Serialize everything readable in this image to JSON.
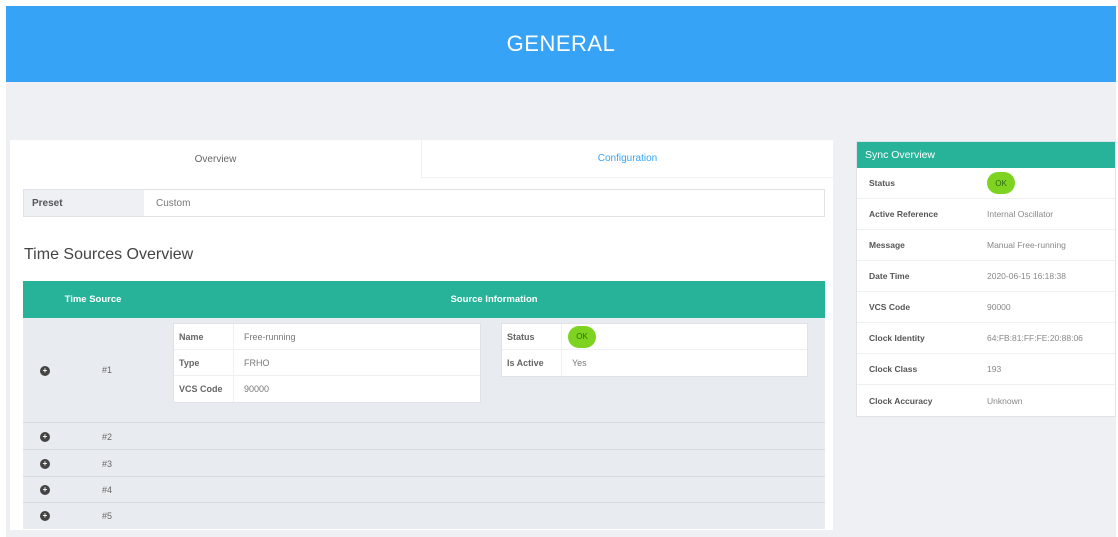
{
  "header": {
    "title": "GENERAL"
  },
  "tabs": [
    {
      "label": "Overview",
      "active": true
    },
    {
      "label": "Configuration",
      "active": false
    }
  ],
  "preset": {
    "label": "Preset",
    "value": "Custom"
  },
  "time_sources": {
    "title": "Time Sources Overview",
    "columns": [
      "Time Source",
      "Source Information"
    ],
    "rows": [
      {
        "index": "#1",
        "expanded": true,
        "details": [
          {
            "key": "Name",
            "value": "Free-running"
          },
          {
            "key": "Type",
            "value": "FRHO"
          },
          {
            "key": "VCS Code",
            "value": "90000"
          }
        ],
        "status": [
          {
            "key": "Status",
            "value": "OK"
          },
          {
            "key": "Is Active",
            "value": "Yes"
          }
        ]
      },
      {
        "index": "#2"
      },
      {
        "index": "#3"
      },
      {
        "index": "#4"
      },
      {
        "index": "#5"
      }
    ]
  },
  "sync_overview": {
    "title": "Sync Overview",
    "rows": [
      {
        "key": "Status",
        "value": "OK"
      },
      {
        "key": "Active Reference",
        "value": "Internal Oscillator"
      },
      {
        "key": "Message",
        "value": "Manual Free-running"
      },
      {
        "key": "Date Time",
        "value": "2020-06-15 16:18:38"
      },
      {
        "key": "VCS Code",
        "value": "90000"
      },
      {
        "key": "Clock Identity",
        "value": "64:FB:81:FF:FE:20:88:06"
      },
      {
        "key": "Clock Class",
        "value": "193"
      },
      {
        "key": "Clock Accuracy",
        "value": "Unknown"
      }
    ]
  },
  "colors": {
    "header": "#36a3f7",
    "teal": "#27b39a",
    "ok_green": "#7ed321",
    "page_bg": "#eef0f4"
  },
  "icons": {
    "expand": "plus-circle-icon"
  }
}
